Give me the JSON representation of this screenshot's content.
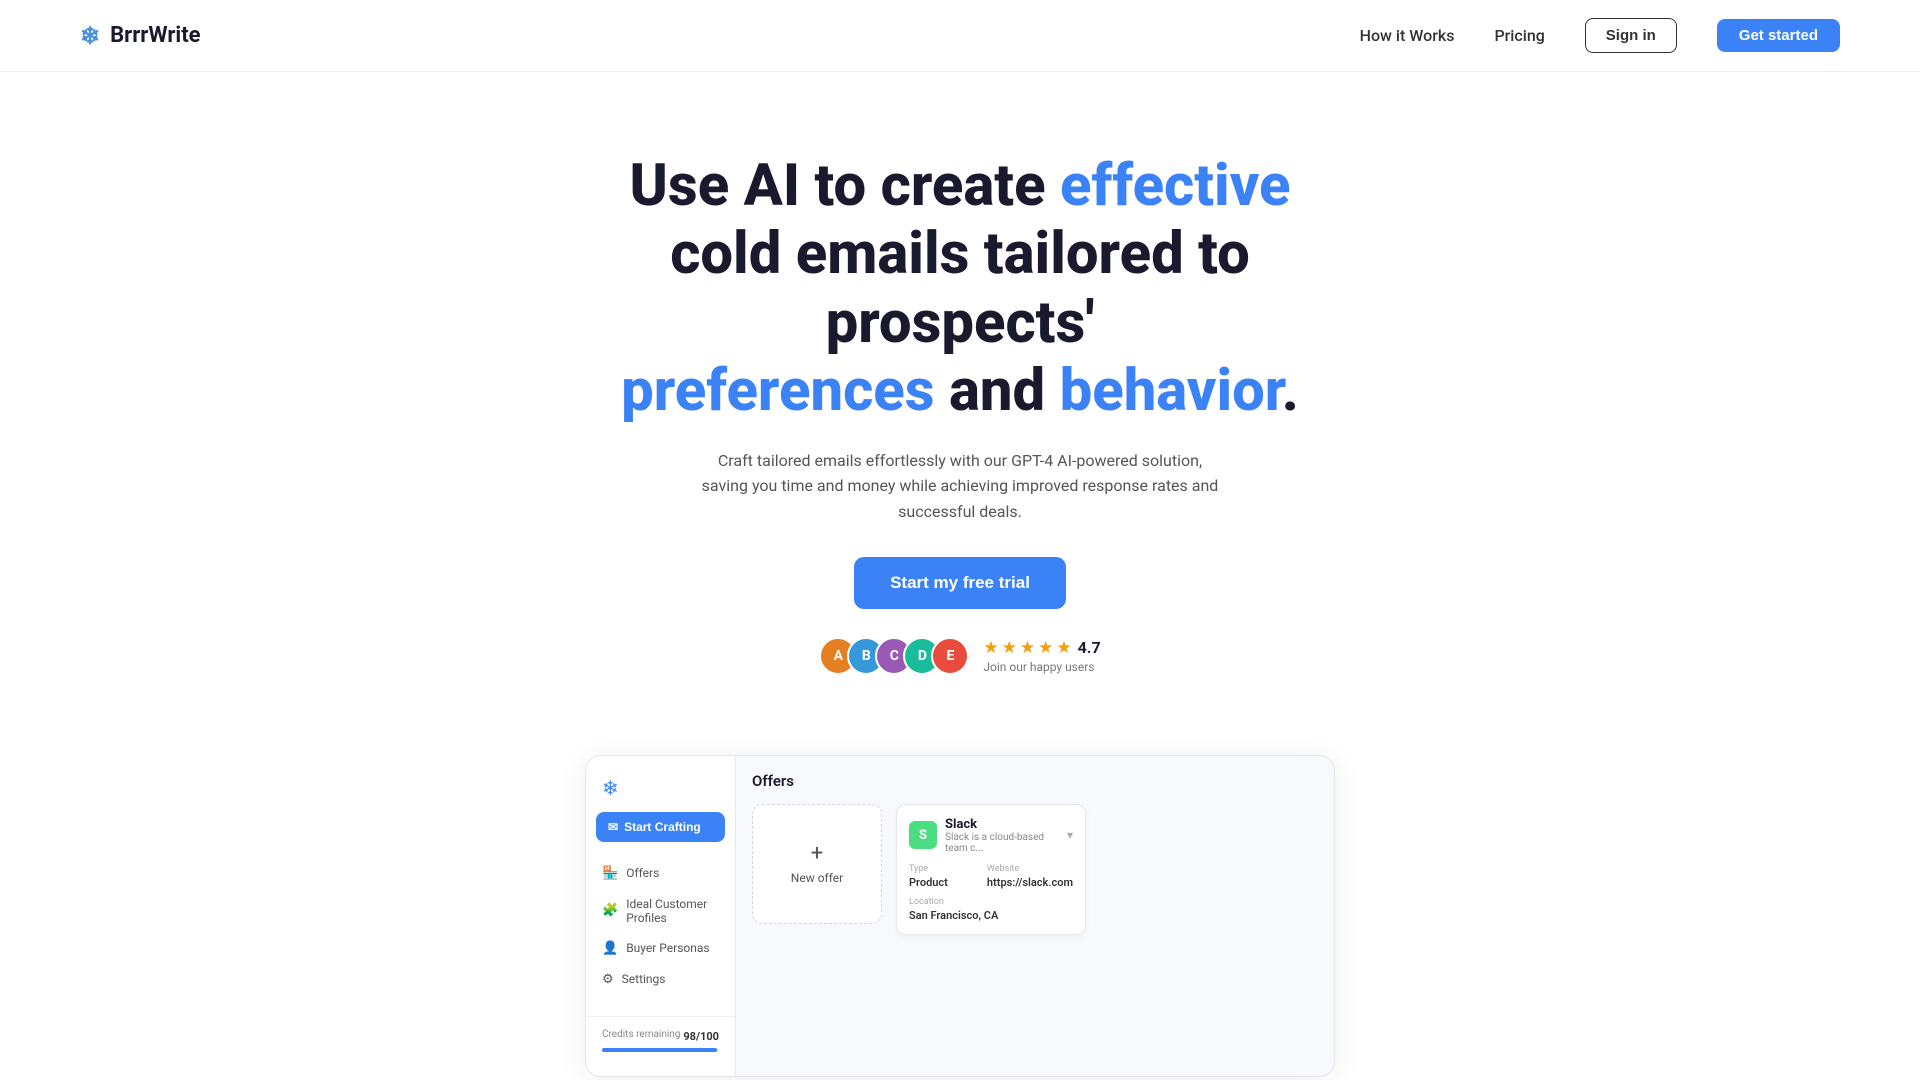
{
  "brand": {
    "name": "BrrrWrite",
    "logo_icon": "❄"
  },
  "nav": {
    "how_it_works": "How it Works",
    "pricing": "Pricing",
    "sign_in": "Sign in",
    "get_started": "Get started"
  },
  "hero": {
    "headline_part1": "Use AI to create ",
    "headline_highlight1": "effective",
    "headline_part2": " cold emails tailored to prospects'",
    "headline_highlight2": "preferences",
    "headline_part3": " and ",
    "headline_highlight3": "behavior",
    "headline_end": ".",
    "subtext": "Craft tailored emails effortlessly with our GPT-4 AI-powered solution, saving you time and money while achieving improved response rates and successful deals.",
    "cta_label": "Start my free trial",
    "rating_value": "4.7",
    "rating_label": "Join our happy users",
    "stars_count": 5
  },
  "app_preview": {
    "sidebar": {
      "start_btn": "Start Crafting",
      "nav_items": [
        {
          "icon": "🏪",
          "label": "Offers"
        },
        {
          "icon": "🧩",
          "label": "Ideal Customer Profiles"
        },
        {
          "icon": "👤",
          "label": "Buyer Personas"
        },
        {
          "icon": "⚙",
          "label": "Settings"
        }
      ],
      "credits_label": "Credits remaining",
      "credits_value": "98/100"
    },
    "main": {
      "section_title": "Offers",
      "new_offer_label": "New offer",
      "offer_card": {
        "name": "Slack",
        "logo": "S",
        "logo_bg": "#4ade80",
        "description": "Slack is a cloud-based team c...",
        "type_label": "Type",
        "type_value": "Product",
        "website_label": "Website",
        "website_value": "https://slack.com",
        "location_label": "Location",
        "location_value": "San Francisco, CA"
      }
    }
  },
  "colors": {
    "blue": "#3b82f6",
    "star": "#f59e0b",
    "text_dark": "#1a1a2e",
    "text_muted": "#555555"
  }
}
